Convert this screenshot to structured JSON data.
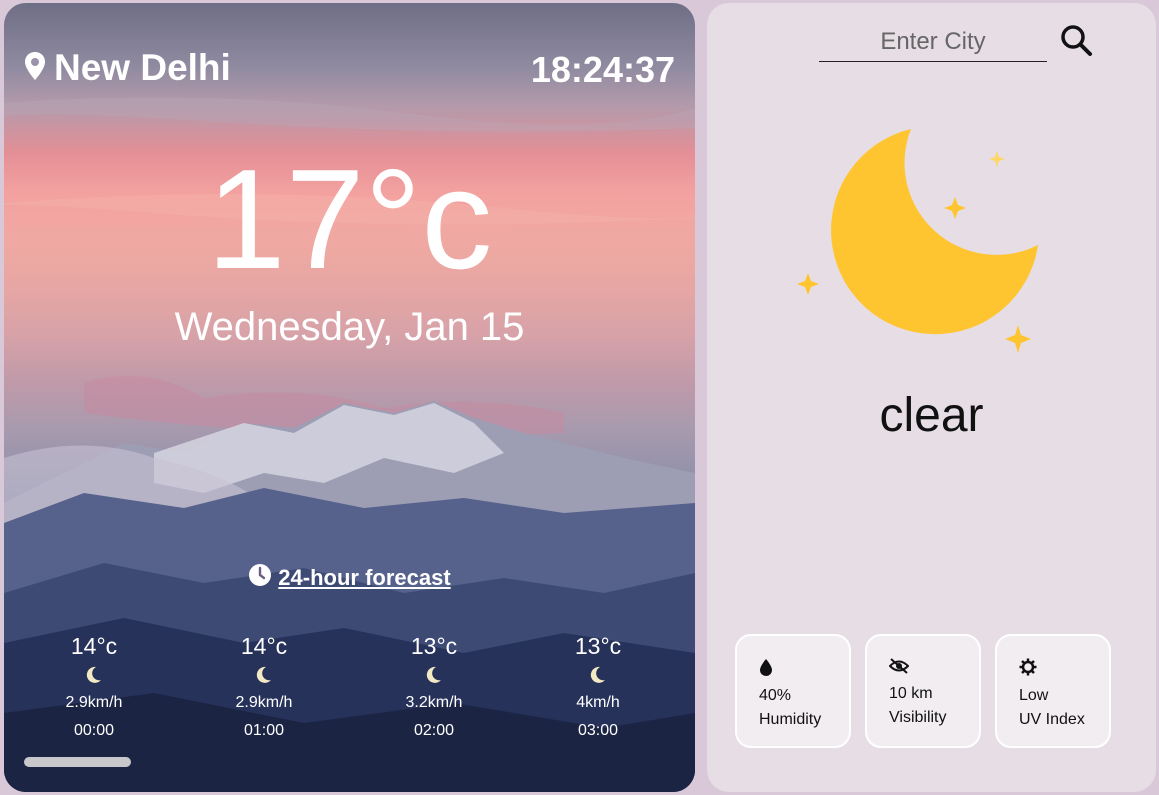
{
  "location": {
    "city": "New Delhi",
    "time": "18:24:37"
  },
  "current": {
    "temperature": "17°c",
    "date": "Wednesday, Jan 15",
    "condition": "clear"
  },
  "forecast": {
    "link_label": "24-hour forecast",
    "hours": [
      {
        "temp": "14°c",
        "wind": "2.9km/h",
        "time": "00:00",
        "icon": "moon-icon"
      },
      {
        "temp": "14°c",
        "wind": "2.9km/h",
        "time": "01:00",
        "icon": "moon-icon"
      },
      {
        "temp": "13°c",
        "wind": "3.2km/h",
        "time": "02:00",
        "icon": "moon-icon"
      },
      {
        "temp": "13°c",
        "wind": "4km/h",
        "time": "03:00",
        "icon": "moon-icon"
      }
    ]
  },
  "search": {
    "placeholder": "Enter City",
    "value": ""
  },
  "details": [
    {
      "icon": "droplet-icon",
      "value": "40%",
      "label": "Humidity"
    },
    {
      "icon": "eye-slash-icon",
      "value": "10 km",
      "label": "Visibility"
    },
    {
      "icon": "sun-gear-icon",
      "value": "Low",
      "label": "UV Index"
    }
  ],
  "colors": {
    "moon": "#ffc531",
    "panel": "#e7dde5",
    "page_bg": "#d9c8d8"
  }
}
